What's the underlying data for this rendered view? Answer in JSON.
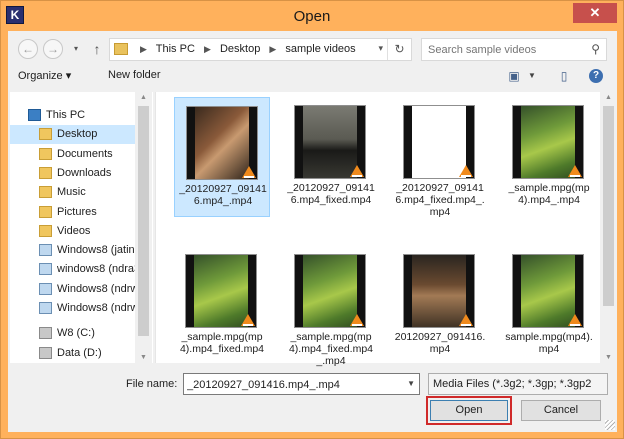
{
  "window": {
    "title": "Open",
    "app_icon_letter": "K",
    "close_glyph": "✕"
  },
  "address_bar": {
    "back_glyph": "←",
    "forward_glyph": "→",
    "up_glyph": "↑",
    "crumbs": [
      "This PC",
      "Desktop",
      "sample videos"
    ],
    "refresh_glyph": "↻"
  },
  "search": {
    "placeholder": "Search sample videos"
  },
  "toolbar": {
    "organize_label": "Organize ▾",
    "new_folder_label": "New folder",
    "help_glyph": "?"
  },
  "nav": {
    "items": [
      {
        "label": "This PC",
        "icon": "pc-icon"
      },
      {
        "label": "Desktop",
        "icon": "folder-icon",
        "selected": true
      },
      {
        "label": "Documents",
        "icon": "folder-icon"
      },
      {
        "label": "Downloads",
        "icon": "folder-icon"
      },
      {
        "label": "Music",
        "icon": "folder-icon"
      },
      {
        "label": "Pictures",
        "icon": "folder-icon"
      },
      {
        "label": "Videos",
        "icon": "folder-icon"
      },
      {
        "label": "Windows8 (jatin-",
        "icon": "network-drive-icon"
      },
      {
        "label": "windows8 (ndra3",
        "icon": "network-drive-icon"
      },
      {
        "label": "Windows8 (ndrw",
        "icon": "network-drive-icon"
      },
      {
        "label": "Windows8 (ndrw",
        "icon": "network-drive-icon"
      },
      {
        "label": "W8 (C:)",
        "icon": "drive-icon"
      },
      {
        "label": "Data (D:)",
        "icon": "drive-icon"
      }
    ]
  },
  "files": [
    {
      "name": "_20120927_091416.mp4_.mp4",
      "selected": true,
      "thumb": "woman"
    },
    {
      "name": "_20120927_091416.mp4_fixed.mp4",
      "thumb": "cowboy"
    },
    {
      "name": "_20120927_091416.mp4_fixed.mp4_.mp4",
      "thumb": "blank"
    },
    {
      "name": "_sample.mpg(mp4).mp4_.mp4",
      "thumb": "grass"
    },
    {
      "name": "_sample.mpg(mp4).mp4_fixed.mp4",
      "thumb": "grass"
    },
    {
      "name": "_sample.mpg(mp4).mp4_fixed.mp4_.mp4",
      "thumb": "grass"
    },
    {
      "name": "20120927_091416.mp4",
      "thumb": "man"
    },
    {
      "name": "sample.mpg(mp4).mp4",
      "thumb": "grass"
    }
  ],
  "footer": {
    "file_name_label": "File name:",
    "file_name_value": "_20120927_091416.mp4_.mp4",
    "file_type_value": "Media Files (*.3g2; *.3gp; *.3gp2",
    "open_label": "Open",
    "cancel_label": "Cancel"
  },
  "colors": {
    "accent_title": "#ffb15c",
    "selection": "#cce8ff",
    "highlight_outline": "#d02a2a"
  }
}
